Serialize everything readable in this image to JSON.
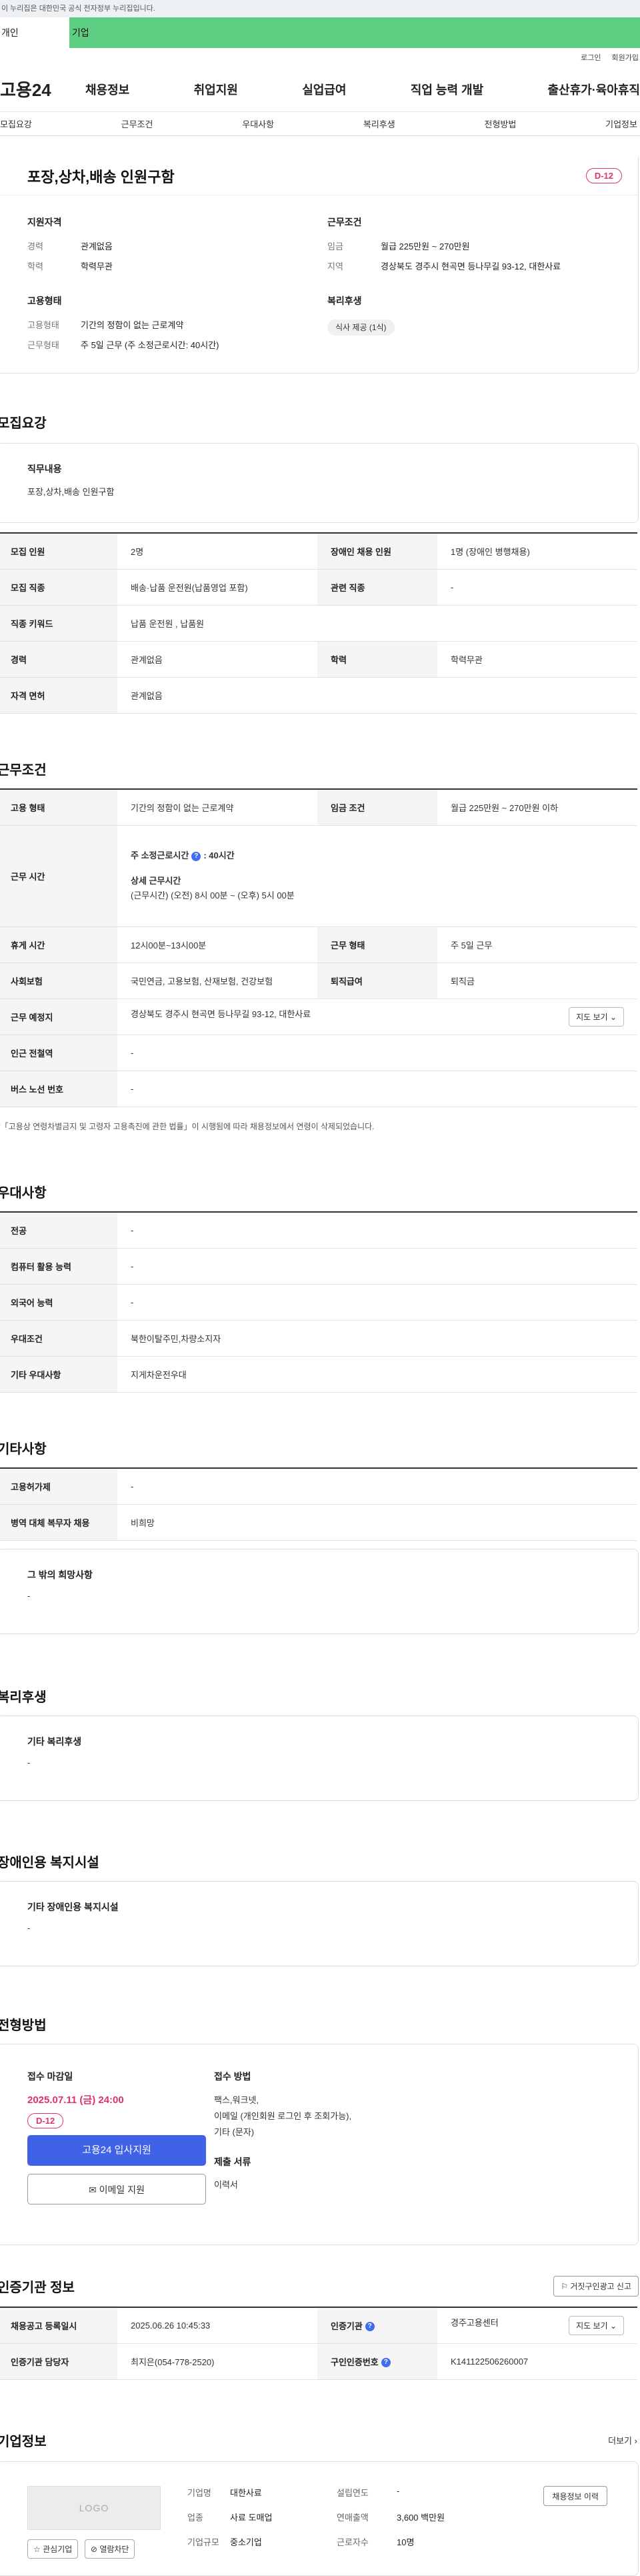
{
  "top": {
    "gov_banner": "이 누리집은 대한민국 공식 전자정부 누리집입니다.",
    "tab_individual": "개인",
    "tab_company": "기업",
    "login": "로그인",
    "join": "회원가입"
  },
  "gnb": {
    "logo": "고용24",
    "menu": [
      "채용정보",
      "취업지원",
      "실업급여",
      "직업 능력 개발",
      "출산휴가·육아휴직"
    ]
  },
  "lnb": [
    "모집요강",
    "근무조건",
    "우대사항",
    "복리후생",
    "전형방법",
    "기업정보"
  ],
  "summary": {
    "title": "포장,상차,배송 인원구함",
    "dday": "D-12",
    "qual_title": "지원자격",
    "qual": [
      {
        "k": "경력",
        "v": "관계없음"
      },
      {
        "k": "학력",
        "v": "학력무관"
      }
    ],
    "cond_title": "근무조건",
    "cond": [
      {
        "k": "임금",
        "v": "월급 225만원 ~ 270만원"
      },
      {
        "k": "지역",
        "v": "경상북도 경주시 현곡면 등나무길 93-12, 대한사료"
      }
    ],
    "emp_title": "고용형태",
    "emp": [
      {
        "k": "고용형태",
        "v": "기간의 정함이 없는 근로계약"
      },
      {
        "k": "근무형태",
        "v": "주 5일 근무 (주 소정근로시간: 40시간)"
      }
    ],
    "welfare_title": "복리후생",
    "welfare_chip": "식사 제공 (1식)"
  },
  "recruit": {
    "title": "모집요강",
    "duty_title": "직무내용",
    "duty_text": "포장,상차,배송 인원구함",
    "rows": [
      [
        {
          "k": "모집 인원",
          "v": "2명"
        },
        {
          "k": "장애인 채용 인원",
          "v": "1명 (장애인 병행채용)"
        }
      ],
      [
        {
          "k": "모집 직종",
          "v": "배송·납품 운전원(납품영업 포함)"
        },
        {
          "k": "관련 직종",
          "v": "-"
        }
      ],
      [
        {
          "k": "직종 키워드",
          "v": "납품 운전원 , 납품원"
        }
      ],
      [
        {
          "k": "경력",
          "v": "관계없음"
        },
        {
          "k": "학력",
          "v": "학력무관"
        }
      ],
      [
        {
          "k": "자격 면허",
          "v": "관계없음"
        }
      ]
    ]
  },
  "work": {
    "title": "근무조건",
    "emp_type_k": "고용 형태",
    "emp_type_v": "기간의 정함이 없는 근로계약",
    "wage_k": "임금 조건",
    "wage_v": "월급 225만원 ~ 270만원 이하",
    "hours_k": "근무 시간",
    "hours_line1": "주 소정근로시간",
    "hours_line1_val": ": 40시간",
    "hours_line2": "상세 근무시간",
    "hours_line3": "(근무시간) (오전) 8시 00분 ~ (오후) 5시 00분",
    "break_k": "휴게 시간",
    "break_v": "12시00분~13시00분",
    "worktype_k": "근무 형태",
    "worktype_v": "주 5일 근무",
    "insurance_k": "사회보험",
    "insurance_v": "국민연금, 고용보험, 산재보험, 건강보험",
    "retire_k": "퇴직급여",
    "retire_v": "퇴직금",
    "place_k": "근무 예정지",
    "place_v": "경상북도 경주시 현곡면 등나무길 93-12, 대한사료",
    "map_btn": "지도 보기",
    "subway_k": "인근 전철역",
    "subway_v": "-",
    "bus_k": "버스 노선 번호",
    "bus_v": "-",
    "note": "*「고용상 연령차별금지 및 고령자 고용촉진에 관한 법률」이 시행됨에 따라 채용정보에서 연령이 삭제되었습니다."
  },
  "prefer": {
    "title": "우대사항",
    "rows": [
      {
        "k": "전공",
        "v": "-"
      },
      {
        "k": "컴퓨터 활용 능력",
        "v": "-"
      },
      {
        "k": "외국어 능력",
        "v": "-"
      },
      {
        "k": "우대조건",
        "v": "북한이탈주민,차량소지자"
      },
      {
        "k": "기타 우대사항",
        "v": "지게차운전우대"
      }
    ]
  },
  "etc": {
    "title": "기타사항",
    "rows": [
      {
        "k": "고용허가제",
        "v": "-"
      },
      {
        "k": "병역 대체 복무자 채용",
        "v": "비희망"
      }
    ],
    "wish_title": "그 밖의 희망사항",
    "wish_text": "-"
  },
  "welfare": {
    "title": "복리후생",
    "box_title": "기타 복리후생",
    "box_text": "-"
  },
  "disabled": {
    "title": "장애인용 복지시설",
    "box_title": "기타 장애인용 복지시설",
    "box_text": "-"
  },
  "selection": {
    "title": "전형방법",
    "deadline_title": "접수 마감일",
    "deadline": "2025.07.11 (금) 24:00",
    "dday": "D-12",
    "apply_btn": "고용24 입사지원",
    "email_btn": "이메일 지원",
    "method_title": "접수 방법",
    "methods": [
      "팩스,워크넷,",
      "이메일 (개인회원 로그인 후 조회가능),",
      "기타 (문자)"
    ],
    "docs_title": "제출 서류",
    "docs": "이력서"
  },
  "cert": {
    "title": "인증기관 정보",
    "report_btn": "거짓구인광고 신고",
    "reg_k": "채용공고 등록일시",
    "reg_v": "2025.06.26 10:45:33",
    "agency_k": "인증기관",
    "agency_v": "경주고용센터",
    "map_btn": "지도 보기",
    "staff_k": "인증기관 담당자",
    "staff_v": "최지은(054-778-2520)",
    "no_k": "구인인증번호",
    "no_v": "K141122506260007"
  },
  "company": {
    "title": "기업정보",
    "more": "더보기",
    "logo": "LOGO",
    "fav_btn": "관심기업",
    "block_btn": "열람차단",
    "info": [
      {
        "k": "기업명",
        "v": "대한사료",
        "k2": "설립연도",
        "v2": "-"
      },
      {
        "k": "업종",
        "v": "사료 도매업",
        "k2": "연매출액",
        "v2": "3,600 백만원"
      },
      {
        "k": "기업규모",
        "v": "중소기업",
        "k2": "근로자수",
        "v2": "10명"
      }
    ],
    "history_btn": "채용정보 이력"
  },
  "colors": {
    "accent": "#3f62e8",
    "dday": "#e0306f",
    "company_tab": "#5dce82"
  }
}
